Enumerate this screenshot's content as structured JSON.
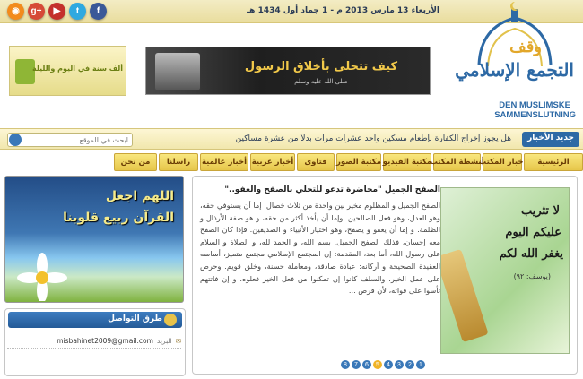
{
  "topbar": {
    "date": "الأربعاء 13 مارس 2013 م - 1 جماد أول 1434 هـ",
    "social": [
      {
        "name": "rss-icon",
        "glyph": "◉",
        "color": "#f28b1d"
      },
      {
        "name": "google-plus-icon",
        "glyph": "g+",
        "color": "#d64937"
      },
      {
        "name": "youtube-icon",
        "glyph": "▶",
        "color": "#c4302b"
      },
      {
        "name": "twitter-icon",
        "glyph": "t",
        "color": "#2fa9e0"
      },
      {
        "name": "facebook-icon",
        "glyph": "f",
        "color": "#3b5998"
      }
    ]
  },
  "logo": {
    "line1": "وقف",
    "line2": "التجمع الإسلامي",
    "latin1": "DEN MUSLIMSKE",
    "latin2": "SAMMENSLUTNING"
  },
  "banner_main": {
    "title": "كيف تتحلى بأخلاق الرسول",
    "subtitle": "صلى الله عليه وسلم"
  },
  "banner_side": {
    "text": "ألف سنة في اليوم والليلة"
  },
  "news": {
    "label": "جديد الأخبار",
    "text": "هل يجوز إخراج الكفارة بإطعام مسكين واحد عشرات مرات بدلا من عشرة مساكين",
    "search_placeholder": "ابحث في الموقع..."
  },
  "nav": [
    "الرئيسية",
    "أخبار المكتب",
    "أنشطة المكتب",
    "مكتبة الفيديو",
    "مكتبة الصور",
    "فتاوى",
    "أخبار عربية",
    "أخبار عالمية",
    "راسلنا",
    "من نحن"
  ],
  "article": {
    "title": "الصفح الجميل \"محاضرة تدعو للتحلي بالصفح والعفو..\"",
    "body": "الصفح الجميل و المظلوم مخير بين واحدة من ثلاث خصال: إما أن يستوفي حقه، وهو العدل، وهو فعل الصالحين. وإما أن يأخذ أكثر من حقه، و هو صفة الأرذال و الظلمة. و إما أن يعفو و يصفح، وهو اختيار الأنبياء و الصديقين. فإذا كان الصفح معه إحسان، فذلك الصفح الجميل. بسم الله، و الحمد لله، و الصلاة و السلام على رسول الله، أما بعد، المقدمة: إن المجتمع الإسلامي مجتمع متميز، أساسه العقيدة الصحيحة و أركانه: عبادة صادقة، ومعاملة حسنة، وخلق قويم. وحرص على عمل الخير، والسلف كانوا إن تمكنوا من فعل الخير فعلوه، و إن فاتتهم تأسوا على فواته، لأن فرص ...",
    "image_text_1": "لا تثريب",
    "image_text_2": "عليكم اليوم",
    "image_text_3": "يغفر الله لكم",
    "image_text_4": "(يوسف: ٩٢)"
  },
  "pager": [
    "8",
    "7",
    "6",
    "5",
    "4",
    "3",
    "2",
    "1"
  ],
  "left_banner": {
    "line1": "اللهم اجعل",
    "line2": "القرآن ربيع قلوبنا"
  },
  "contact": {
    "heading": "طرق التواصل",
    "email_label": "البريد",
    "email": "misbahinet2009@gmail.com"
  }
}
